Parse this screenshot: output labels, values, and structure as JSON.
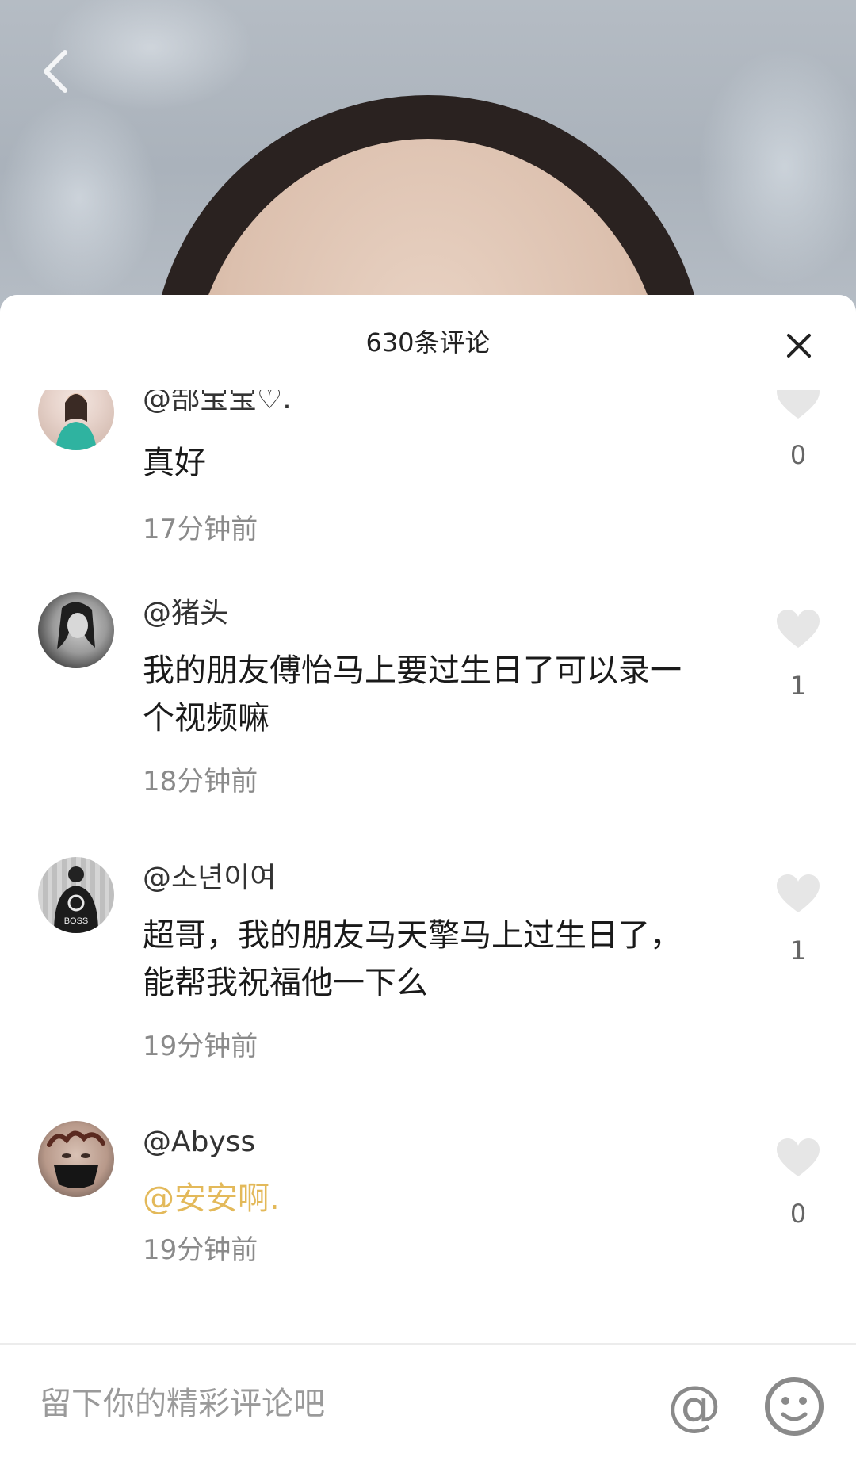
{
  "header": {
    "title": "630条评论"
  },
  "comments": [
    {
      "username": "@郜宝宝♡.",
      "text": "真好",
      "time": "17分钟前",
      "likes": "0"
    },
    {
      "username": "@猪头",
      "text": "我的朋友傅怡马上要过生日了可以录一个视频嘛",
      "time": "18分钟前",
      "likes": "1"
    },
    {
      "username": "@소년이여",
      "text": "超哥，我的朋友马天擎马上过生日了，能帮我祝福他一下么",
      "time": "19分钟前",
      "likes": "1"
    },
    {
      "username": "@Abyss",
      "text": "@安安啊.",
      "time": "19分钟前",
      "likes": "0"
    }
  ],
  "input": {
    "placeholder": "留下你的精彩评论吧"
  },
  "colors": {
    "mention": "#e3b95a",
    "like_icon": "#e6e6e6",
    "timestamp": "#8a8a8a"
  }
}
